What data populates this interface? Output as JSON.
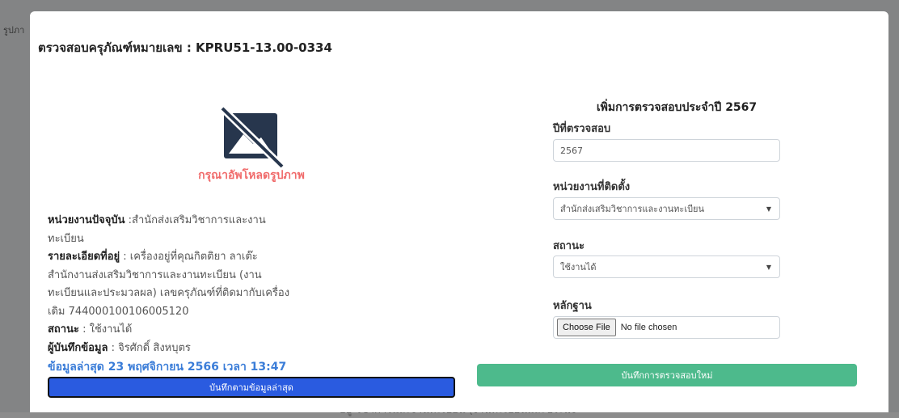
{
  "background": {
    "label": "รูปภา",
    "bottom_text": "อยู่ วิชาการและงานทะเบียน (งานทะเบียนและประมง"
  },
  "modal": {
    "title": "ตรวจสอบครุภัณฑ์หมายเลข : KPRU51-13.00-0334"
  },
  "left": {
    "image_icon": "no-image-icon",
    "upload_prompt": "กรุณาอัพโหลดรูปภาพ",
    "info": {
      "unit_label": "หน่วยงานปัจจุบัน",
      "unit_value": " :สำนักส่งเสริมวิชาการและงานทะเบียน",
      "detail_label": "รายละเอียดที่อยู่",
      "detail_value": " : เครื่องอยู่ที่คุณกิตติยา ลาเต๊ะ สำนักงานส่งเสริมวิชาการและงานทะเบียน (งานทะเบียนและประมวลผล) เลขครุภัณฑ์ที่ติดมากับเครื่องเดิม 744000100106005120",
      "status_label": "สถานะ",
      "status_value": " : ใช้งานได้",
      "recorder_label": "ผู้บันทึกข้อมูล",
      "recorder_value": " : จิรศักดิ์ สิงหบุตร"
    },
    "latest": "ข้อมูลล่าสุด 23 พฤศจิกายน 2566 เวลา 13:47",
    "save_latest_button": "บันทึกตามข้อมูลล่าสุด"
  },
  "form": {
    "heading": "เพิ่มการตรวจสอบประจำปี 2567",
    "year_label": "ปีที่ตรวจสอบ",
    "year_value": "2567",
    "unit_label": "หน่วยงานที่ติดตั้ง",
    "unit_selected": "สำนักส่งเสริมวิชาการและงานทะเบียน",
    "status_label": "สถานะ",
    "status_selected": "ใช้งานได้",
    "evidence_label": "หลักฐาน",
    "choose_file": "Choose File",
    "no_file": "No file chosen",
    "save_new_button": "บันทึกการตรวจสอบใหม่"
  },
  "colors": {
    "upload_prompt": "#f06a6a",
    "latest": "#3b7dd8",
    "save_latest_bg": "#2a5be0",
    "save_new_bg": "#4dba8c",
    "icon": "#27364d"
  }
}
